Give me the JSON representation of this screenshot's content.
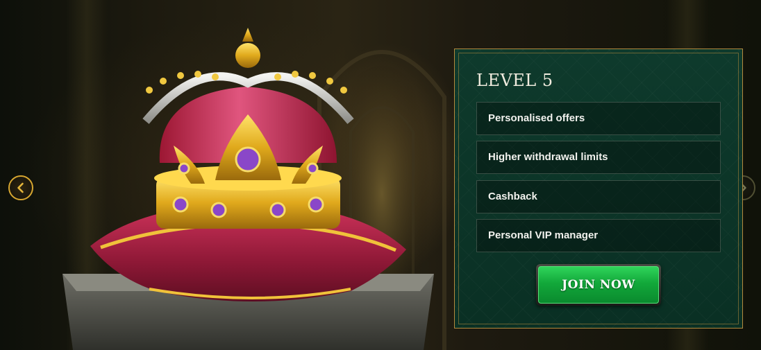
{
  "colors": {
    "card_bg": "#0e3a2c",
    "card_border": "#b48a3e",
    "button_green": "#12a83a",
    "arrow_gold": "#d6a630"
  },
  "hero": {
    "image": "crown-on-pillow"
  },
  "navigation": {
    "prev_icon": "chevron-left-icon",
    "next_icon": "chevron-right-icon"
  },
  "card": {
    "title": "LEVEL 5",
    "benefits": [
      {
        "label": "Personalised offers"
      },
      {
        "label": "Higher withdrawal limits"
      },
      {
        "label": "Cashback"
      },
      {
        "label": "Personal VIP manager"
      }
    ],
    "cta_label": "JOIN NOW"
  }
}
